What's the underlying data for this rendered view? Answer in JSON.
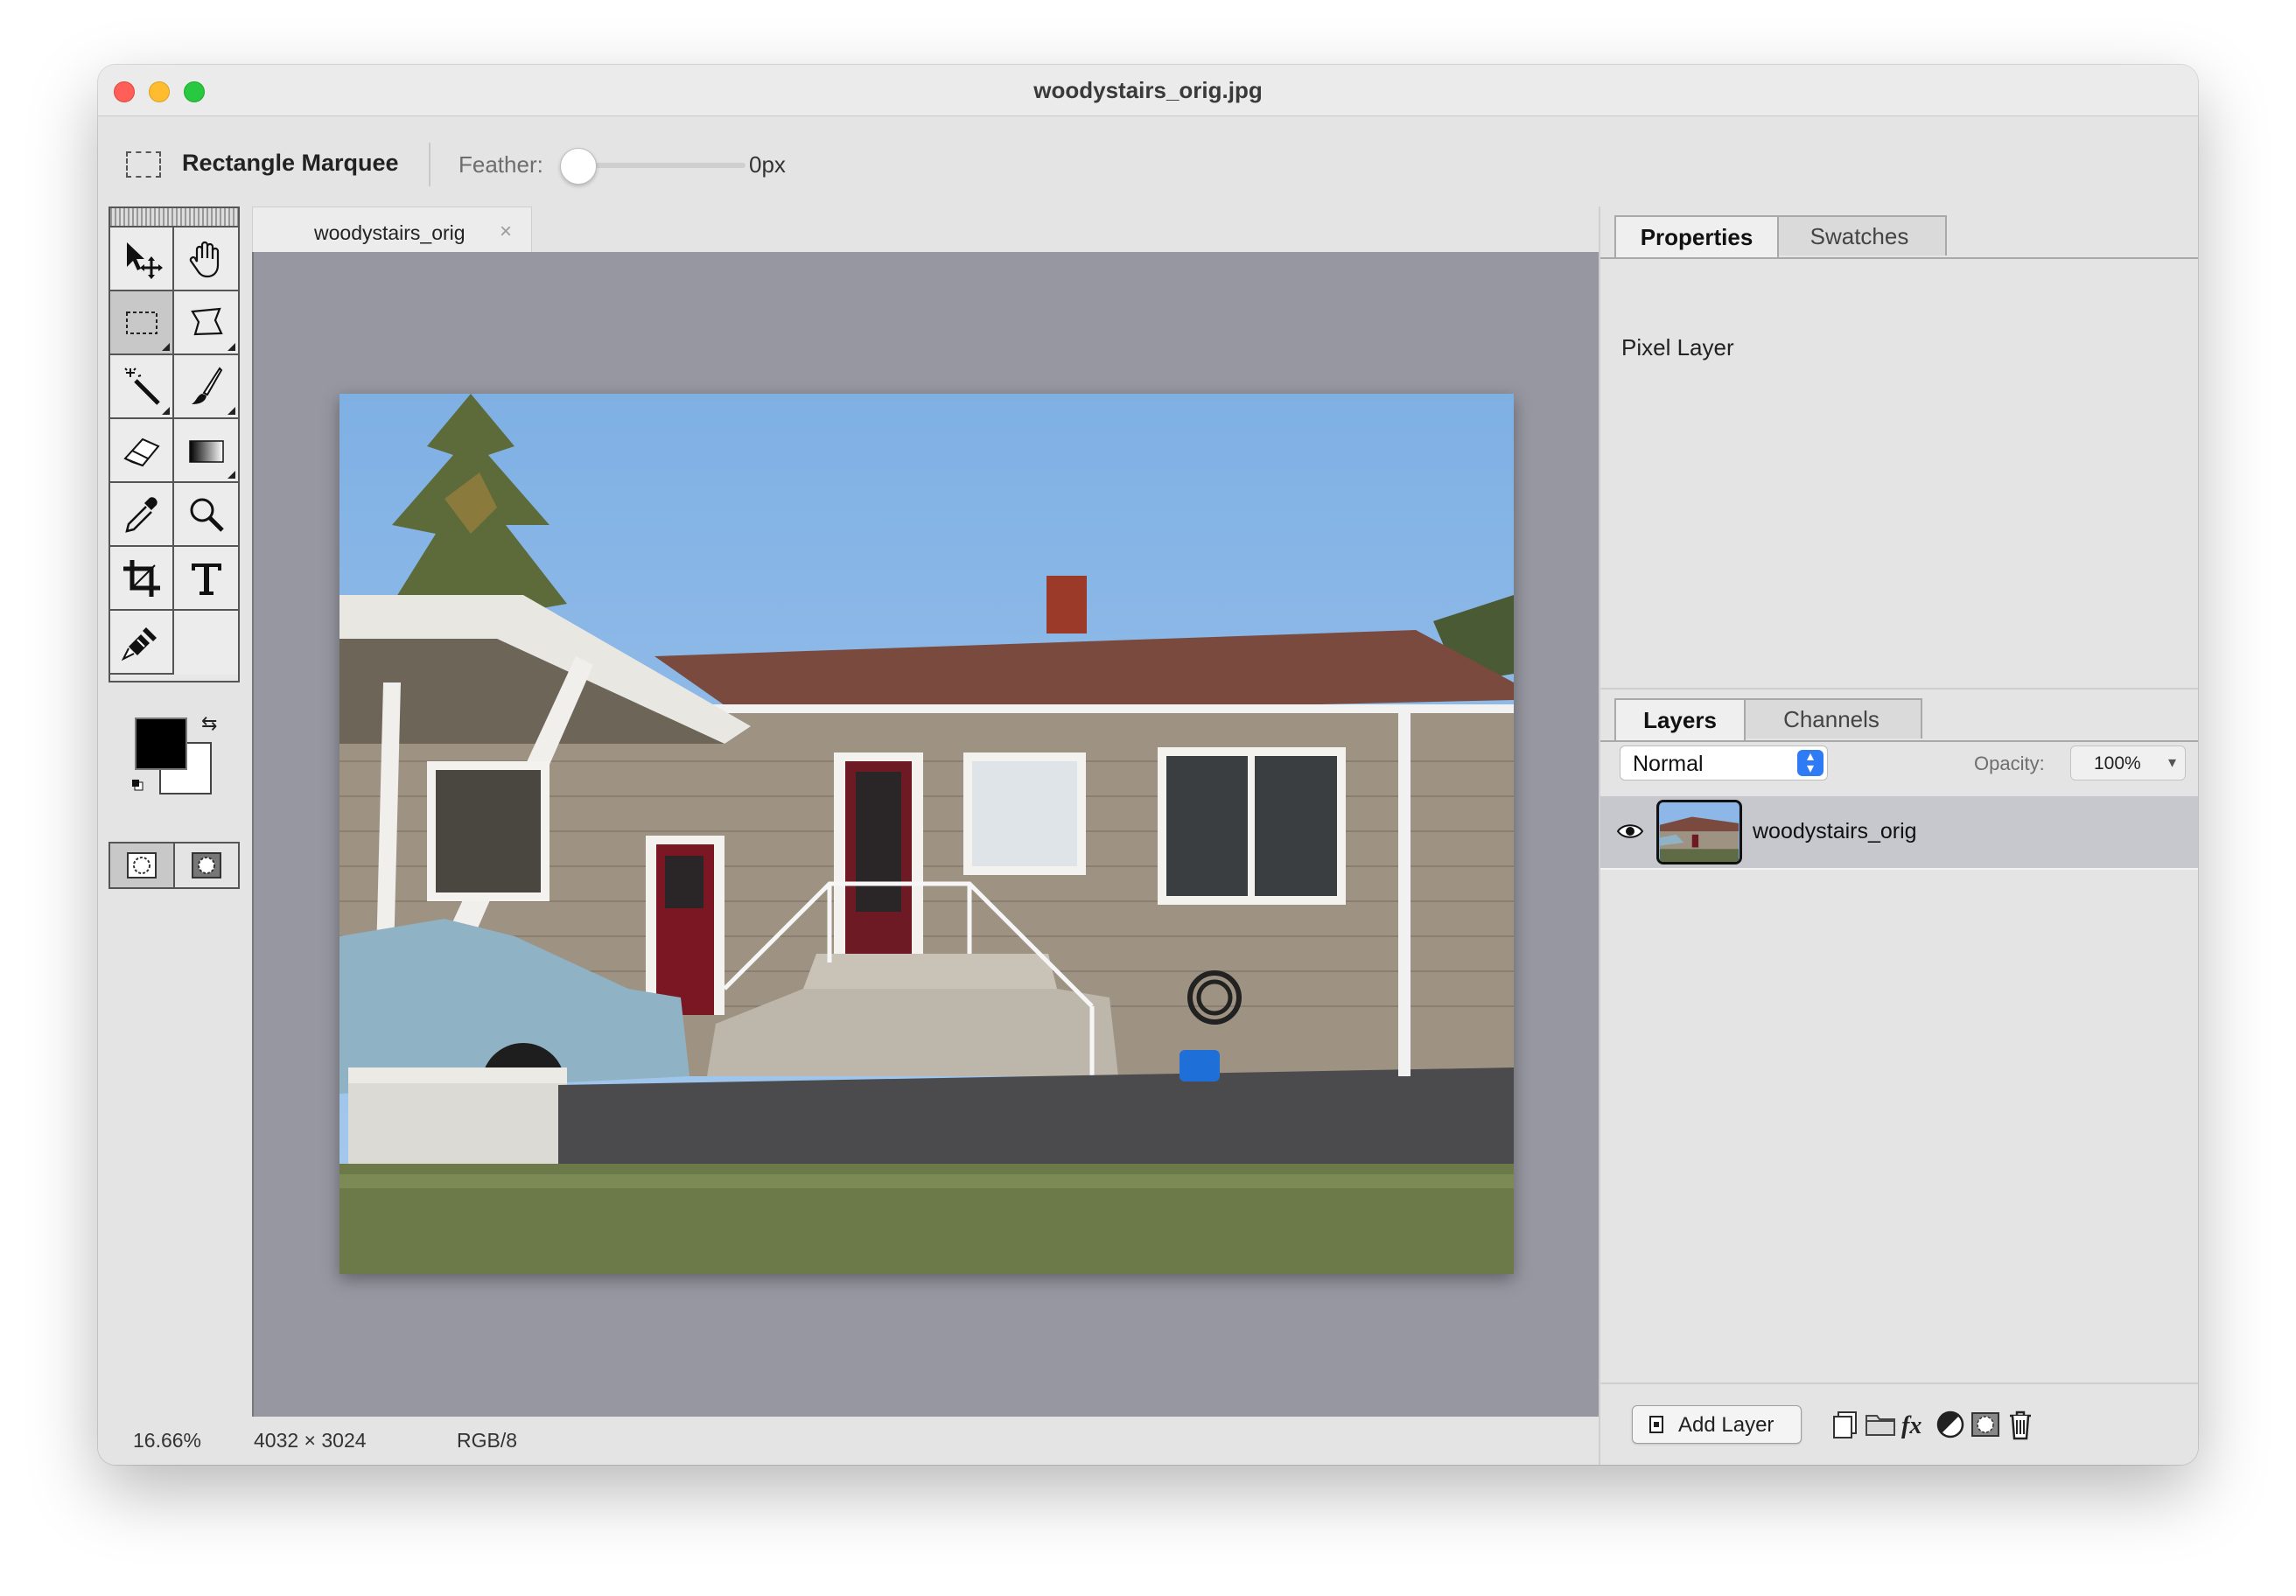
{
  "window": {
    "title": "woodystairs_orig.jpg"
  },
  "options": {
    "tool_name": "Rectangle Marquee",
    "feather_label": "Feather:",
    "feather_value": "0px",
    "feather_fraction": 0.0
  },
  "document": {
    "tab_label": "woodystairs_orig",
    "tab_close": "×",
    "new_tab": "+"
  },
  "status": {
    "zoom": "16.66%",
    "dimensions": "4032 × 3024",
    "mode": "RGB/8"
  },
  "top_panel": {
    "tabs": [
      "Properties",
      "Swatches"
    ],
    "active_tab": "Properties",
    "content": "Pixel Layer"
  },
  "layers_panel": {
    "tabs": [
      "Layers",
      "Channels"
    ],
    "active_tab": "Layers",
    "blend_mode": "Normal",
    "opacity_label": "Opacity:",
    "opacity_value": "100%",
    "layers": [
      {
        "name": "woodystairs_orig",
        "visible": true,
        "selected": true
      }
    ],
    "add_layer_label": "Add Layer"
  },
  "colors": {
    "foreground": "#000000",
    "background": "#ffffff",
    "canvas_bg": "#9797a1",
    "accent": "#2f7bf5"
  },
  "icons": {
    "toolbox": [
      "move-icon",
      "hand-icon",
      "rectangle-marquee-icon",
      "lasso-icon",
      "magic-wand-icon",
      "brush-icon",
      "eraser-icon",
      "gradient-icon",
      "eyedropper-icon",
      "zoom-icon",
      "crop-icon",
      "text-icon",
      "clone-stamp-icon"
    ],
    "layers_footer": [
      "duplicate-layer-icon",
      "folder-icon",
      "fx-icon",
      "adjustment-icon",
      "mask-icon",
      "trash-icon"
    ]
  }
}
